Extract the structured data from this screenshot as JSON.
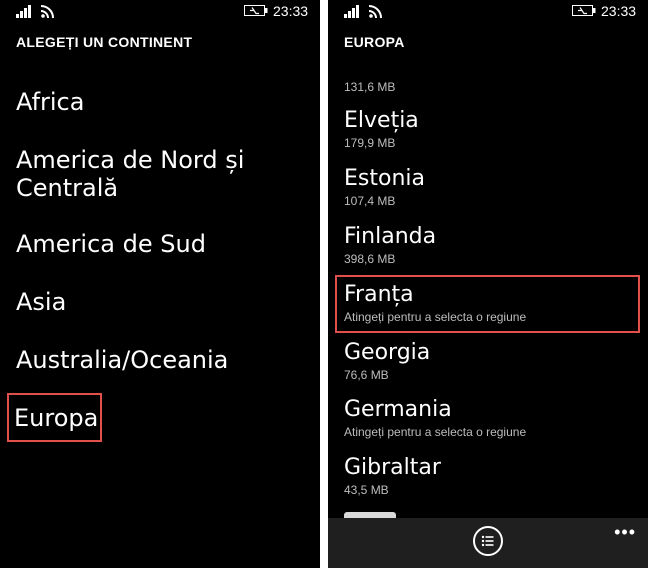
{
  "status": {
    "time": "23:33"
  },
  "left": {
    "title": "ALEGEȚI UN CONTINENT",
    "continents": [
      {
        "label": "Africa"
      },
      {
        "label": "America de Nord și Centrală"
      },
      {
        "label": "America de Sud"
      },
      {
        "label": "Asia"
      },
      {
        "label": "Australia/Oceania"
      },
      {
        "label": "Europa",
        "highlighted": true
      }
    ]
  },
  "right": {
    "title": "EUROPA",
    "top_size": "131,6 MB",
    "countries": [
      {
        "name": "Elveția",
        "detail": "179,9 MB"
      },
      {
        "name": "Estonia",
        "detail": "107,4 MB"
      },
      {
        "name": "Finlanda",
        "detail": "398,6 MB"
      },
      {
        "name": "Franța",
        "detail": "Atingeți pentru a selecta o regiune",
        "highlighted": true
      },
      {
        "name": "Georgia",
        "detail": "76,6 MB"
      },
      {
        "name": "Germania",
        "detail": "Atingeți pentru a selecta o regiune"
      },
      {
        "name": "Gibraltar",
        "detail": "43,5 MB"
      }
    ],
    "appbar": {
      "list_icon": "list-icon",
      "more_label": "•••"
    }
  },
  "colors": {
    "highlight": "#e2504b",
    "background": "#000000",
    "appbar": "#1f1f1f"
  }
}
